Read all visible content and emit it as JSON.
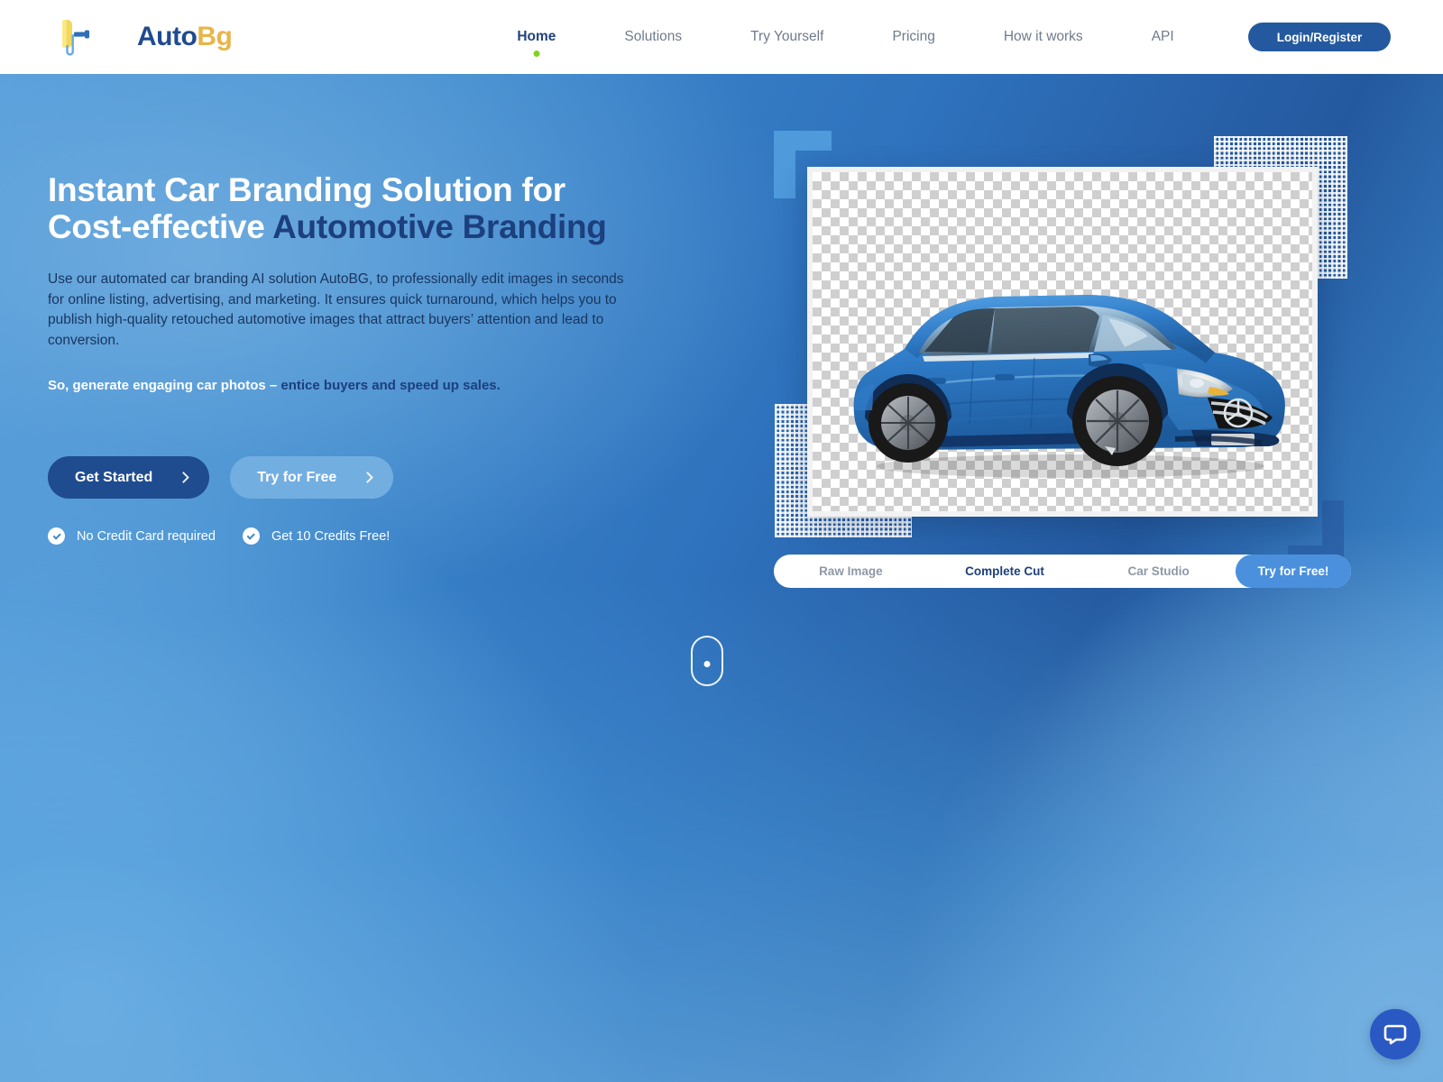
{
  "header": {
    "logo": {
      "icon": "paint-roller-icon",
      "text_primary": "Auto",
      "text_secondary": "Bg"
    },
    "nav": [
      {
        "label": "Home",
        "active": true
      },
      {
        "label": "Solutions",
        "active": false
      },
      {
        "label": "Try Yourself",
        "active": false
      },
      {
        "label": "Pricing",
        "active": false
      },
      {
        "label": "How it works",
        "active": false
      },
      {
        "label": "API",
        "active": false
      }
    ],
    "login_label": "Login/Register"
  },
  "hero": {
    "headline_line1": "Instant Car Branding Solution for",
    "headline_line2_white": "Cost-effective ",
    "headline_line2_accent": "Automotive Branding",
    "lead": "Use our automated car branding AI solution AutoBG, to professionally edit images in seconds for online listing, advertising, and marketing. It ensures quick turnaround, which helps you to publish high-quality retouched automotive images that attract buyers’ attention and lead to conversion.",
    "tagline_white": "So, generate engaging car photos – ",
    "tagline_accent": "entice buyers and speed up sales.",
    "cta_primary": "Get Started",
    "cta_secondary": "Try for Free",
    "features": [
      {
        "icon": "check-circle-icon",
        "label": "No Credit Card required"
      },
      {
        "icon": "check-circle-icon",
        "label": "Get 10 Credits Free!"
      }
    ]
  },
  "showcase": {
    "image_alt": "blue-mercedes-hatchback-cutout",
    "tabs": [
      {
        "label": "Raw Image",
        "active": false
      },
      {
        "label": "Complete Cut",
        "active": true
      },
      {
        "label": "Car Studio",
        "active": false
      }
    ],
    "try_free_label": "Try for Free!"
  },
  "widgets": {
    "scroll_indicator": "mouse-scroll-icon",
    "chat": "chat-bubble-icon"
  },
  "colors": {
    "brand_navy": "#1f4b8e",
    "brand_gold": "#e8b54a",
    "accent_blue": "#4a90dd",
    "active_dot_green": "#7ed321",
    "deep_navy": "#1c3f7d"
  }
}
